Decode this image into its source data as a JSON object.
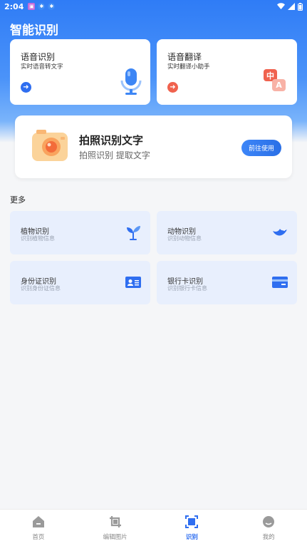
{
  "status_bar": {
    "time": "2:04"
  },
  "app_title": "智能识别",
  "voice_card": {
    "title": "语音识别",
    "subtitle": "实时语音转文字"
  },
  "translate_card": {
    "title": "语音翻译",
    "subtitle": "实时翻译小助手",
    "icon_char_cn": "中",
    "icon_char_en": "A"
  },
  "photo_card": {
    "title": "拍照识别文字",
    "subtitle": "拍照识别  提取文字",
    "button_label": "前往使用"
  },
  "more_label": "更多",
  "tiles": [
    {
      "title": "植物识别",
      "subtitle": "识别植物信息"
    },
    {
      "title": "动物识别",
      "subtitle": "识别动物信息"
    },
    {
      "title": "身份证识别",
      "subtitle": "识别身份证信息"
    },
    {
      "title": "银行卡识别",
      "subtitle": "识别银行卡信息"
    }
  ],
  "nav": [
    {
      "label": "首页"
    },
    {
      "label": "编辑图片"
    },
    {
      "label": "识别"
    },
    {
      "label": "我的"
    }
  ],
  "colors": {
    "primary": "#2f6ef0",
    "accent_red": "#f0624e",
    "tile_bg": "#e8effd"
  }
}
